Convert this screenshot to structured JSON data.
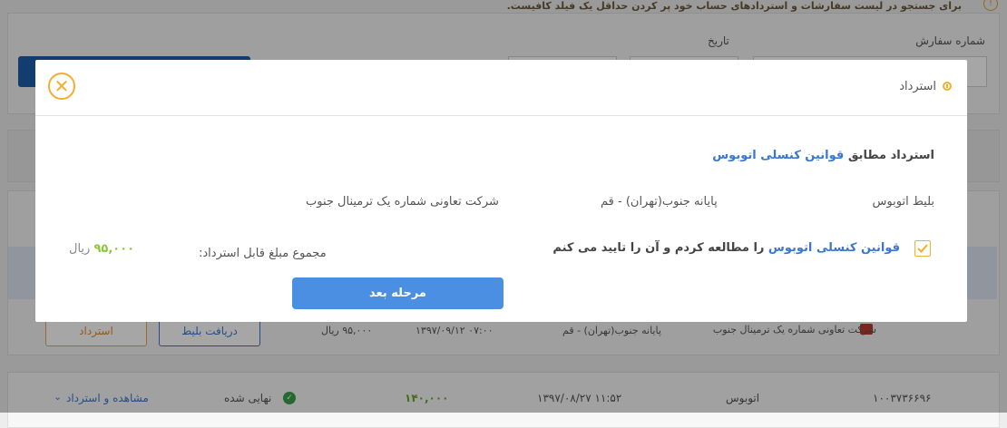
{
  "background": {
    "notice": "برای جستجو در لیست سفارشات و استردادهای حساب خود پر کردن حداقل یک فیلد کافیست.",
    "order_number_label": "شماره سفارش",
    "date_label": "تاریخ",
    "order_row": {
      "company": "شرکت تعاونی شماره یک ترمینال جنوب",
      "route": "پایانه جنوب(تهران) - قم",
      "datetime": "۱۳۹۷/۰۹/۱۲  ۰۷:۰۰",
      "price": "۹۵,۰۰۰ ریال",
      "get_ticket_button": "دریافت بلیط",
      "refund_button": "استرداد"
    },
    "history_row": {
      "order_id": "۱۰۰۳۷۳۶۶۹۶",
      "type": "اتوبوس",
      "datetime": "۱۳۹۷/۰۸/۲۷  ۱۱:۵۲",
      "price": "۱۴۰,۰۰۰",
      "status": "نهایی شده",
      "view_refund_link": "مشاهده و استرداد"
    }
  },
  "modal": {
    "title": "استرداد",
    "rule_prefix": "استرداد مطابق",
    "rule_link": "قوانین کنسلی اتوبوس",
    "ticket_type": "بلیط اتوبوس",
    "route": "پایانه جنوب(تهران) - قم",
    "company": "شرکت تعاونی شماره یک ترمینال جنوب",
    "agree_link": "قوانین کنسلی اتوبوس",
    "agree_suffix": "را مطالعه کردم و آن را تایید می کنم",
    "agree_checked": true,
    "total_label": "مجموع مبلغ قابل استرداد:",
    "amount_value": "۹۵,۰۰۰",
    "amount_currency": "ریال",
    "next_button": "مرحله بعد"
  },
  "colors": {
    "accent_orange": "#f2ae2e",
    "link_blue": "#3a78cf",
    "button_blue": "#4b8fe2",
    "amount_green": "#8fc53a"
  }
}
